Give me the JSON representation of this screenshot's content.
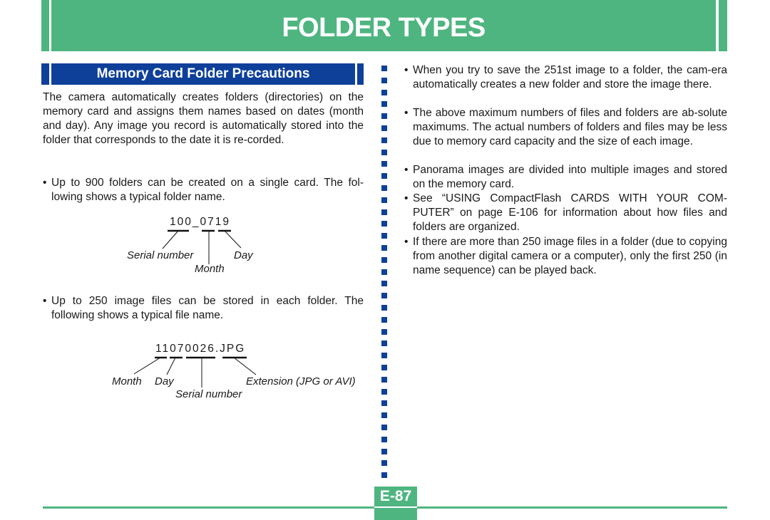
{
  "header": {
    "title": "FOLDER TYPES"
  },
  "section": {
    "title": "Memory Card Folder Precautions"
  },
  "left_column": {
    "intro": "The camera automatically creates folders (directories) on the memory card and assigns them names based on dates (month and day). Any image you record is automatically stored into the folder that corresponds to the date it is re-corded.",
    "bullet_symbol": "•",
    "bullets": [
      "Up to 900 folders can be created on a single card. The fol-lowing shows a typical folder name.",
      "Up to 250 image files can be stored in each folder. The following shows a typical file name."
    ],
    "folder_diagram": {
      "example": "100_0719",
      "labels": {
        "serial": "Serial number",
        "month": "Month",
        "day": "Day"
      }
    },
    "file_diagram": {
      "example": "11070026.JPG",
      "labels": {
        "month": "Month",
        "day": "Day",
        "serial": "Serial number",
        "extension": "Extension (JPG or AVI)"
      }
    }
  },
  "right_column": {
    "bullets": [
      "When you try to save the 251st image to a folder, the cam-era automatically creates a new folder and store the image there.",
      "The above maximum numbers of files and folders are ab-solute maximums. The actual numbers of folders and files may be less due to memory card capacity and the size of each image.",
      "Panorama images are divided into multiple images and stored on the memory card.",
      "See “USING CompactFlash CARDS WITH YOUR COM-PUTER” on page E-106 for information about how files and folders are organized.",
      "If there are more than 250 image files in a folder (due to copying from another digital camera or a computer), only the first 250 (in name sequence) can be played back."
    ]
  },
  "footer": {
    "page_number": "E-87"
  },
  "colors": {
    "green": "#4fb580",
    "blue": "#0e409a"
  }
}
